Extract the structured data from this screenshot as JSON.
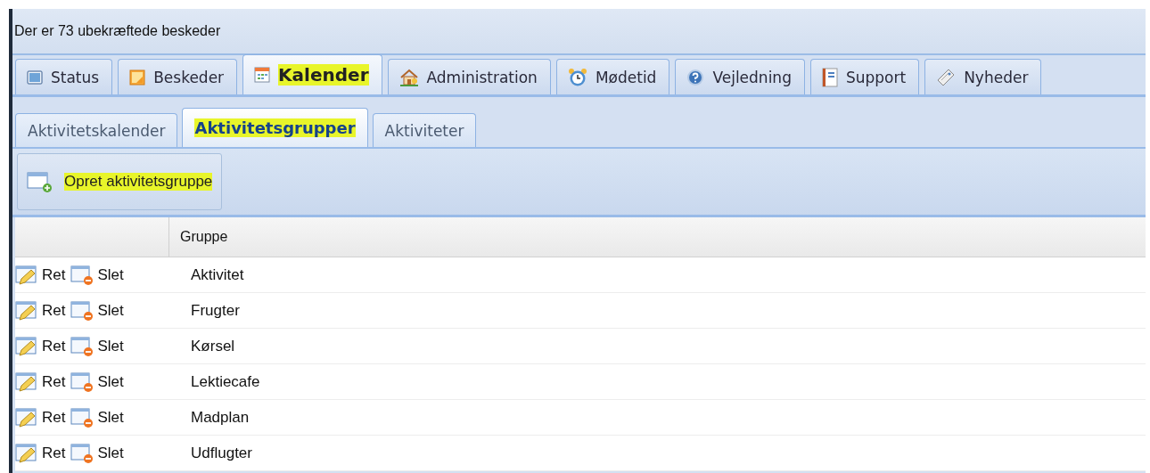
{
  "notice": "Der er 73 ubekræftede beskeder",
  "tabs": [
    {
      "label": "Status",
      "selected": false,
      "highlighted": false
    },
    {
      "label": "Beskeder",
      "selected": false,
      "highlighted": false
    },
    {
      "label": "Kalender",
      "selected": true,
      "highlighted": true
    },
    {
      "label": "Administration",
      "selected": false,
      "highlighted": false
    },
    {
      "label": "Mødetid",
      "selected": false,
      "highlighted": false
    },
    {
      "label": "Vejledning",
      "selected": false,
      "highlighted": false
    },
    {
      "label": "Support",
      "selected": false,
      "highlighted": false
    },
    {
      "label": "Nyheder",
      "selected": false,
      "highlighted": false
    }
  ],
  "subtabs": [
    {
      "label": "Aktivitetskalender",
      "selected": false,
      "highlighted": false
    },
    {
      "label": "Aktivitetsgrupper",
      "selected": true,
      "highlighted": true
    },
    {
      "label": "Aktiviteter",
      "selected": false,
      "highlighted": false
    }
  ],
  "toolbar": {
    "create_button": {
      "label": "Opret aktivitetsgruppe",
      "highlighted": true
    }
  },
  "table": {
    "columns": [
      "Gruppe"
    ],
    "rows": [
      {
        "edit": "Ret",
        "delete": "Slet",
        "group": "Aktivitet"
      },
      {
        "edit": "Ret",
        "delete": "Slet",
        "group": "Frugter"
      },
      {
        "edit": "Ret",
        "delete": "Slet",
        "group": "Kørsel"
      },
      {
        "edit": "Ret",
        "delete": "Slet",
        "group": "Lektiecafe"
      },
      {
        "edit": "Ret",
        "delete": "Slet",
        "group": "Madplan"
      },
      {
        "edit": "Ret",
        "delete": "Slet",
        "group": "Udflugter"
      }
    ]
  }
}
